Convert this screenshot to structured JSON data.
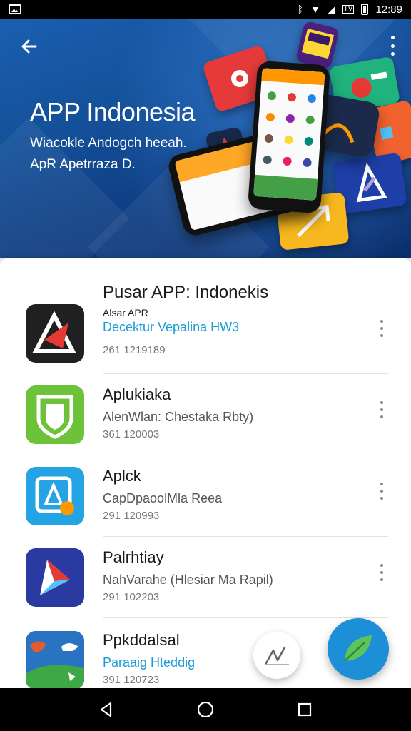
{
  "status_bar": {
    "time": "12:89",
    "icons": [
      "notification-icon",
      "bluetooth-icon",
      "wifi-icon",
      "signal-icon",
      "tv-icon",
      "battery-icon"
    ]
  },
  "banner": {
    "title": "APP Indonesia",
    "subtitle": "Wiacokle Andogch heeah. ApR Apetrraza D.",
    "colors": {
      "top": "#1a5fb0",
      "bottom": "#0c2f6c"
    }
  },
  "list": {
    "heading": "Pusar APP: Indonekis",
    "items": [
      {
        "name": "Alsar APR",
        "desc": "Decektur Vepalina HW3",
        "meta": "261 1219189",
        "icon": "red-arrow-app-icon"
      },
      {
        "name": "Aplukiaka",
        "desc": "AlenWlan: Chestaka Rbty)",
        "meta": "361 120003",
        "icon": "green-shield-app-icon"
      },
      {
        "name": "Aplck",
        "desc": "CapDpaoolMla Reea",
        "meta": "291 120993",
        "icon": "blue-square-app-icon"
      },
      {
        "name": "Palrhtiay",
        "desc": "NahVarahe (Hlesiar Ma Rapil)",
        "meta": "291 102203",
        "icon": "navy-arrow-app-icon"
      },
      {
        "name": "Ppkddalsal",
        "desc": "Paraaig Hteddig",
        "meta": "391 120723",
        "icon": "map-landscape-app-icon"
      }
    ]
  },
  "fabs": {
    "small_icon": "signature-icon",
    "big_icon": "leaf-icon",
    "accent": "#1d8fd6"
  },
  "nav": {
    "back": "back-triangle-icon",
    "home": "home-circle-icon",
    "recents": "recents-square-icon"
  }
}
